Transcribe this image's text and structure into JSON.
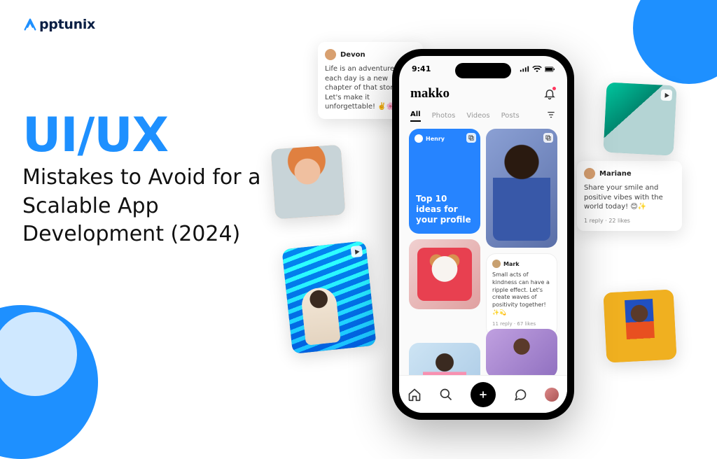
{
  "logo": {
    "text": "pptunix"
  },
  "headline": {
    "big": "UI/UX",
    "sub": "Mistakes to Avoid for a Scalable App Development (2024)"
  },
  "cards": {
    "devon": {
      "name": "Devon",
      "text": "Life is an adventure, and each day is a new chapter of that story. Let's make it unforgettable! ✌️🌸"
    },
    "mariane": {
      "name": "Mariane",
      "text": "Share your smile and positive vibes with the world today! 😊✨",
      "meta": "1 reply · 22 likes"
    }
  },
  "phone": {
    "time": "9:41",
    "brand": "makko",
    "tabs": {
      "all": "All",
      "photos": "Photos",
      "videos": "Videos",
      "posts": "Posts"
    },
    "grid": {
      "henry": "Henry",
      "blue_title": "Top 10 ideas for your profile",
      "mark": {
        "name": "Mark",
        "text": "Small acts of kindness can have a ripple effect. Let's create waves of positivity together! ✨💫",
        "meta": "11 reply · 67 likes"
      }
    }
  }
}
